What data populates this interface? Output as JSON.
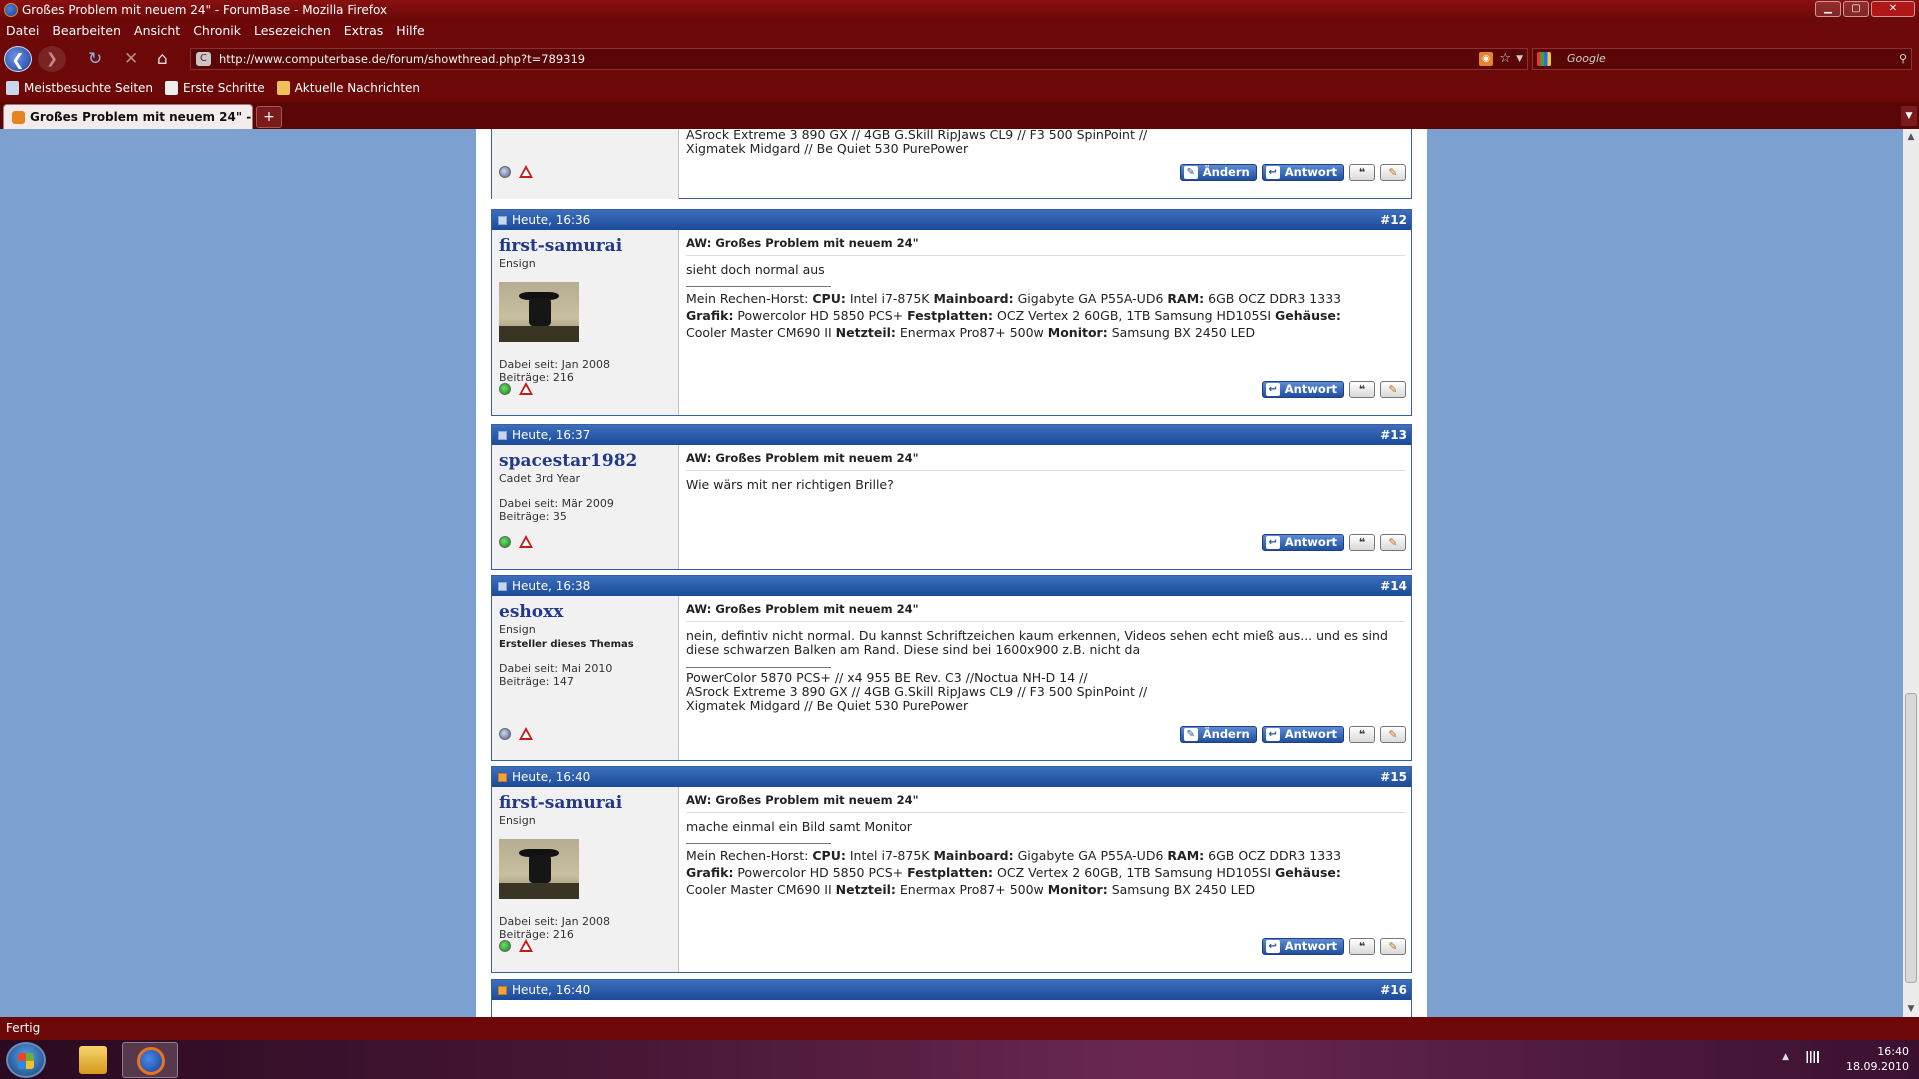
{
  "window": {
    "title": "Großes Problem mit neuem 24\" - ForumBase - Mozilla Firefox"
  },
  "menu": [
    "Datei",
    "Bearbeiten",
    "Ansicht",
    "Chronik",
    "Lesezeichen",
    "Extras",
    "Hilfe"
  ],
  "url": "http://www.computerbase.de/forum/showthread.php?t=789319",
  "search_placeholder": "Google",
  "bookmarks": [
    "Meistbesuchte Seiten",
    "Erste Schritte",
    "Aktuelle Nachrichten"
  ],
  "tab": {
    "title": "Großes Problem mit neuem 24\" - For...",
    "new": "+"
  },
  "top_post": {
    "sig_line1": "ASrock Extreme 3 890 GX // 4GB G.Skill RipJaws CL9 // F3 500 SpinPoint //",
    "sig_line2": "Xigmatek Midgard // Be Quiet 530 PurePower"
  },
  "buttons": {
    "edit": "Ändern",
    "reply": "Antwort"
  },
  "posts": [
    {
      "date": "Heute, 16:36",
      "num": "#12",
      "user": "first-samurai",
      "rank": "Ensign",
      "joined": "Dabei seit: Jan 2008",
      "posts": "Beiträge: 216",
      "title": "AW: Großes Problem mit neuem 24\"",
      "text": "sieht doch normal aus",
      "sig": {
        "intro": "Mein Rechen-Horst:",
        "cpu_l": "CPU:",
        "cpu": "Intel i7-875K",
        "mb_l": "Mainboard:",
        "mb": "Gigabyte GA P55A-UD6",
        "ram_l": "RAM:",
        "ram": "6GB OCZ DDR3 1333",
        "gfx_l": "Grafik:",
        "gfx": "Powercolor HD 5850 PCS+",
        "hdd_l": "Festplatten:",
        "hdd": "OCZ Vertex 2 60GB, 1TB Samsung HD105SI",
        "case_l": "Gehäuse:",
        "case": "Cooler Master CM690 II",
        "psu_l": "Netzteil:",
        "psu": "Enermax Pro87+ 500w",
        "mon_l": "Monitor:",
        "mon": "Samsung BX 2450 LED"
      }
    },
    {
      "date": "Heute, 16:37",
      "num": "#13",
      "user": "spacestar1982",
      "rank": "Cadet 3rd Year",
      "joined": "Dabei seit: Mär 2009",
      "posts": "Beiträge: 35",
      "title": "AW: Großes Problem mit neuem 24\"",
      "text": "Wie wärs mit ner richtigen Brille?"
    },
    {
      "date": "Heute, 16:38",
      "num": "#14",
      "user": "eshoxx",
      "rank": "Ensign",
      "starter": "Ersteller dieses Themas",
      "joined": "Dabei seit: Mai 2010",
      "posts": "Beiträge: 147",
      "title": "AW: Großes Problem mit neuem 24\"",
      "text": "nein, defintiv nicht normal. Du kannst Schriftzeichen kaum erkennen, Videos sehen echt mieß aus... und es sind diese schwarzen Balken am Rand. Diese sind bei 1600x900 z.B. nicht da",
      "sig1": "PowerColor 5870 PCS+ // x4 955 BE Rev. C3 //Noctua NH-D 14 //",
      "sig2": "ASrock Extreme 3 890 GX // 4GB G.Skill RipJaws CL9 // F3 500 SpinPoint //",
      "sig3": "Xigmatek Midgard // Be Quiet 530 PurePower"
    },
    {
      "date": "Heute, 16:40",
      "num": "#15",
      "user": "first-samurai",
      "rank": "Ensign",
      "joined": "Dabei seit: Jan 2008",
      "posts": "Beiträge: 216",
      "title": "AW: Großes Problem mit neuem 24\"",
      "text": "mache einmal ein Bild samt Monitor"
    },
    {
      "date": "Heute, 16:40",
      "num": "#16"
    }
  ],
  "status": "Fertig",
  "clock": {
    "time": "16:40",
    "date": "18.09.2010"
  }
}
